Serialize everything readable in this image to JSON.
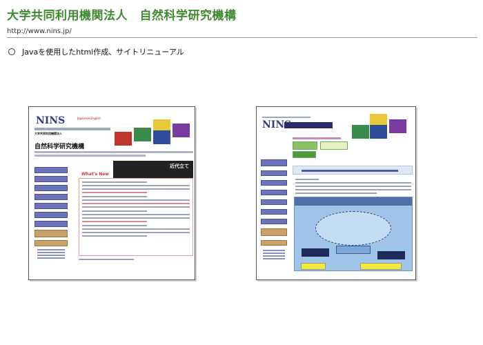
{
  "header": {
    "title": "大学共同利用機関法人　自然科学研究機構",
    "url": "http://www.nins.jp/"
  },
  "item": {
    "text": "Javaを使用したhtml作成、サイトリニューアル"
  },
  "shot1": {
    "logo": "NINS",
    "lang": "Japanese English",
    "name_small": "大学共同利用機関法人",
    "name_large": "自然科学研究機構",
    "whats_new": "What's New",
    "photo_caption": "近代立て"
  },
  "shot2": {
    "logo": "NINS"
  },
  "colors": {
    "title_green": "#3f8a2e",
    "nav_purple": "#6d73b8",
    "nav_tan": "#c9a26b",
    "whats_new_red": "#c0392b",
    "diagram_blue": "#9fc4e8",
    "highlight_yellow": "#f1ea3a"
  }
}
